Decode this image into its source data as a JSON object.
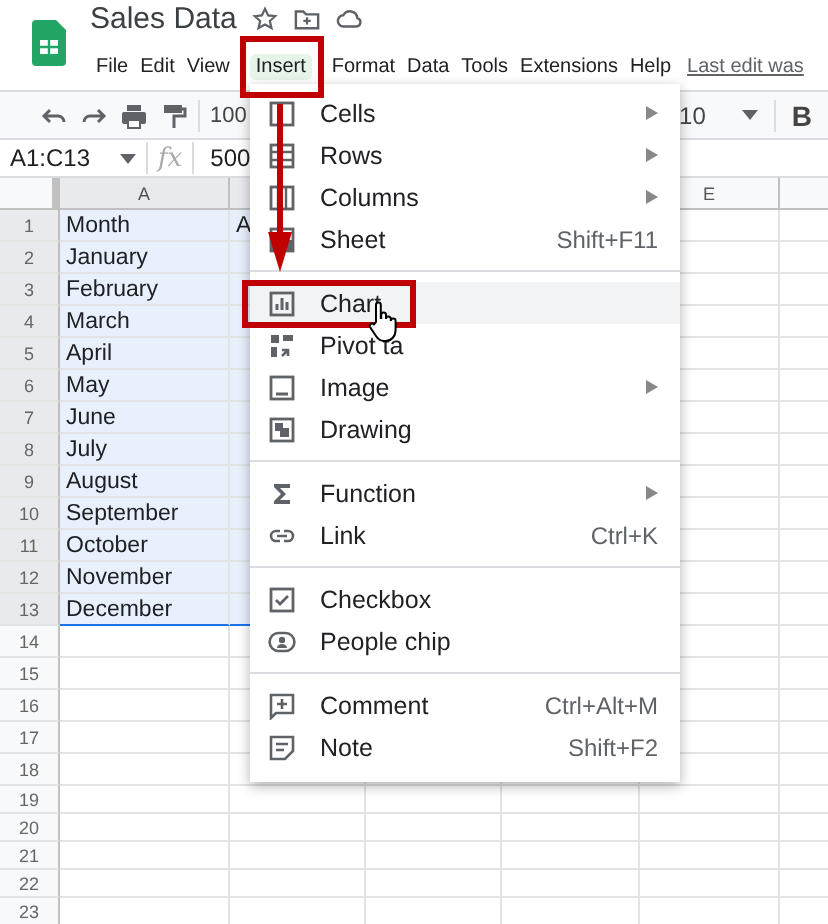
{
  "document": {
    "title": "Sales Data"
  },
  "menu_bar": [
    {
      "label": "File",
      "selected": false
    },
    {
      "label": "Edit",
      "selected": false
    },
    {
      "label": "View",
      "selected": false
    },
    {
      "label": "Insert",
      "selected": true
    },
    {
      "label": "Format",
      "selected": false
    },
    {
      "label": "Data",
      "selected": false
    },
    {
      "label": "Tools",
      "selected": false
    },
    {
      "label": "Extensions",
      "selected": false
    },
    {
      "label": "Help",
      "selected": false
    }
  ],
  "last_edit": "Last edit was",
  "toolbar": {
    "zoom": "100",
    "font_size": "10",
    "bold": "B"
  },
  "formula_bar": {
    "name_box": "A1:C13",
    "fx": "fx",
    "value": "500"
  },
  "grid": {
    "columns": [
      {
        "label": "A",
        "selected": true
      },
      {
        "selected": true
      },
      {},
      {},
      {
        "label": "E",
        "selected": false
      },
      {
        "selected": false
      }
    ],
    "rows": [
      {
        "number": "1",
        "selected": true,
        "cells": [
          "Month",
          "A"
        ]
      },
      {
        "number": "2",
        "selected": true,
        "cells": [
          "January"
        ]
      },
      {
        "number": "3",
        "selected": true,
        "cells": [
          "February"
        ]
      },
      {
        "number": "4",
        "selected": true,
        "cells": [
          "March"
        ]
      },
      {
        "number": "5",
        "selected": true,
        "cells": [
          "April"
        ]
      },
      {
        "number": "6",
        "selected": true,
        "cells": [
          "May"
        ]
      },
      {
        "number": "7",
        "selected": true,
        "cells": [
          "June"
        ]
      },
      {
        "number": "8",
        "selected": true,
        "cells": [
          "July"
        ]
      },
      {
        "number": "9",
        "selected": true,
        "cells": [
          "August"
        ]
      },
      {
        "number": "10",
        "selected": true,
        "cells": [
          "September"
        ]
      },
      {
        "number": "11",
        "selected": true,
        "cells": [
          "October"
        ]
      },
      {
        "number": "12",
        "selected": true,
        "cells": [
          "November"
        ]
      },
      {
        "number": "13",
        "selected": true,
        "cells": [
          "December"
        ]
      },
      {
        "number": "14",
        "selected": false,
        "cells": []
      },
      {
        "number": "15",
        "selected": false,
        "cells": []
      },
      {
        "number": "16",
        "selected": false,
        "cells": []
      },
      {
        "number": "17",
        "selected": false,
        "cells": []
      },
      {
        "number": "18",
        "selected": false,
        "cells": []
      },
      {
        "number": "19",
        "selected": false,
        "cells": []
      },
      {
        "number": "20",
        "selected": false,
        "cells": []
      },
      {
        "number": "21",
        "selected": false,
        "cells": []
      },
      {
        "number": "22",
        "selected": false,
        "cells": []
      },
      {
        "number": "23",
        "selected": false,
        "cells": []
      }
    ]
  },
  "insert_menu": [
    {
      "kind": "item",
      "label": "Cells",
      "submenu": true,
      "selected": false
    },
    {
      "kind": "item",
      "label": "Rows",
      "submenu": true,
      "selected": false
    },
    {
      "kind": "item",
      "label": "Columns",
      "submenu": true,
      "selected": false
    },
    {
      "kind": "item",
      "label": "Sheet",
      "shortcut": "Shift+F11",
      "selected": false
    },
    {
      "kind": "divider"
    },
    {
      "kind": "item",
      "label": "Chart",
      "selected": true
    },
    {
      "kind": "item",
      "label": "Pivot ta",
      "selected": false
    },
    {
      "kind": "item",
      "label": "Image",
      "submenu": true,
      "selected": false
    },
    {
      "kind": "item",
      "label": "Drawing",
      "selected": false
    },
    {
      "kind": "divider"
    },
    {
      "kind": "item",
      "label": "Function",
      "submenu": true,
      "selected": false
    },
    {
      "kind": "item",
      "label": "Link",
      "shortcut": "Ctrl+K",
      "selected": false
    },
    {
      "kind": "divider"
    },
    {
      "kind": "item",
      "label": "Checkbox",
      "selected": false
    },
    {
      "kind": "item",
      "label": "People chip",
      "selected": false
    },
    {
      "kind": "divider"
    },
    {
      "kind": "item",
      "label": "Comment",
      "shortcut": "Ctrl+Alt+M",
      "selected": false
    },
    {
      "kind": "item",
      "label": "Note",
      "shortcut": "Shift+F2",
      "selected": false
    }
  ]
}
